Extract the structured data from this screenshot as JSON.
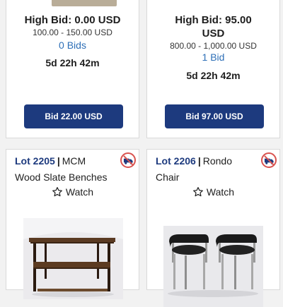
{
  "lots_top": [
    {
      "high_bid": "High Bid: 0.00 USD",
      "estimate": "100.00 - 150.00 USD",
      "bids": "0 Bids",
      "time_left": "5d 22h 42m",
      "bid_button": "Bid 22.00 USD"
    },
    {
      "high_bid_line1": "High Bid: 95.00",
      "high_bid_line2": "USD",
      "estimate": "800.00 - 1,000.00 USD",
      "bids": "1 Bid",
      "time_left": "5d 22h 42m",
      "bid_button": "Bid 97.00 USD"
    }
  ],
  "lots_bottom": [
    {
      "lot_number": "Lot 2205",
      "separator": "|",
      "title_line1": "MCM",
      "title_line2": "Wood Slate Benches",
      "watch_label": "Watch",
      "no_shipping_icon": "no-shipping-icon"
    },
    {
      "lot_number": "Lot 2206",
      "separator": "|",
      "title_line1": "Rondo",
      "title_line2": "Chair",
      "watch_label": "Watch",
      "no_shipping_icon": "no-shipping-icon"
    }
  ],
  "colors": {
    "primary": "#1d3a7e",
    "bid_count": "#2d6fb7",
    "no_shipping": "#d9534f"
  }
}
